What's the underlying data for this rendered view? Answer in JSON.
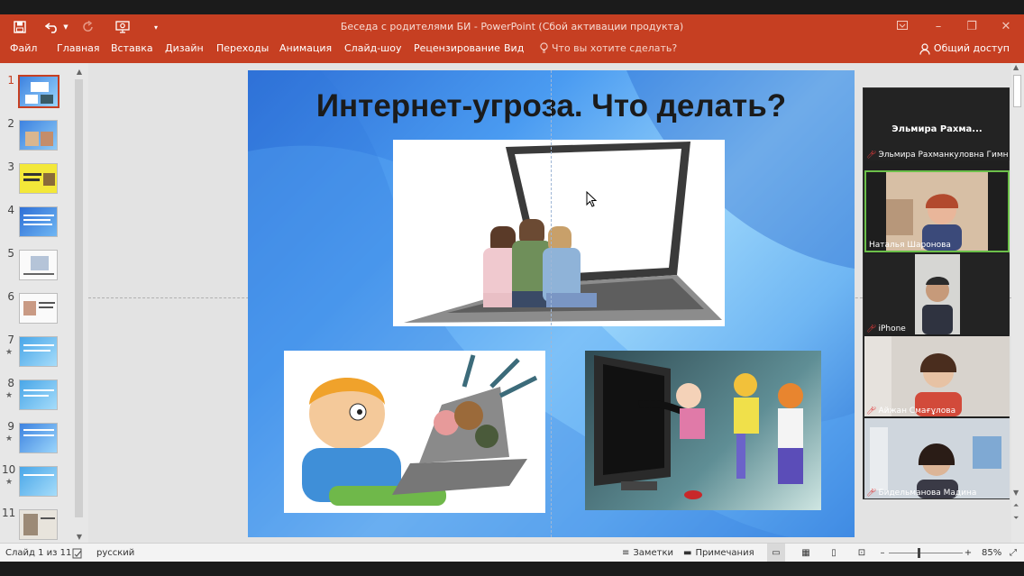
{
  "app": {
    "title": "Беседа с родителями БИ - PowerPoint (Сбой активации продукта)"
  },
  "quick_access": {
    "save_icon": "save-icon",
    "undo_icon": "undo-icon",
    "redo_icon": "redo-icon",
    "slideshow_icon": "start-slideshow-icon",
    "customize_icon": "customize-qat-icon"
  },
  "ribbon": {
    "tabs": [
      "Файл",
      "Главная",
      "Вставка",
      "Дизайн",
      "Переходы",
      "Анимация",
      "Слайд-шоу",
      "Рецензирование",
      "Вид"
    ],
    "tell_me": "Что вы хотите сделать?",
    "share": "Общий доступ"
  },
  "thumbnails": [
    {
      "num": "1",
      "star": ""
    },
    {
      "num": "2",
      "star": ""
    },
    {
      "num": "3",
      "star": ""
    },
    {
      "num": "4",
      "star": ""
    },
    {
      "num": "5",
      "star": ""
    },
    {
      "num": "6",
      "star": ""
    },
    {
      "num": "7",
      "star": "★"
    },
    {
      "num": "8",
      "star": "★"
    },
    {
      "num": "9",
      "star": "★"
    },
    {
      "num": "10",
      "star": "★"
    },
    {
      "num": "11",
      "star": ""
    }
  ],
  "slide": {
    "title": "Интернет-угроза. Что делать?"
  },
  "participants": {
    "header": "Эльмира  Рахма...",
    "list": [
      {
        "name": "Эльмира Рахманкуловна Гимна..."
      },
      {
        "name": "Наталья Шаронова"
      },
      {
        "name": "iPhone"
      },
      {
        "name": "Айжан Смағұлова"
      },
      {
        "name": "Бидельманова Мадина"
      }
    ]
  },
  "status": {
    "slide_counter": "Слайд 1 из 11",
    "language": "русский",
    "notes": "Заметки",
    "comments": "Примечания",
    "zoom": "85%"
  },
  "colors": {
    "accent": "#c63f22",
    "slide_bg": "#4a9bf1",
    "mic_muted": "#e23b3b"
  }
}
